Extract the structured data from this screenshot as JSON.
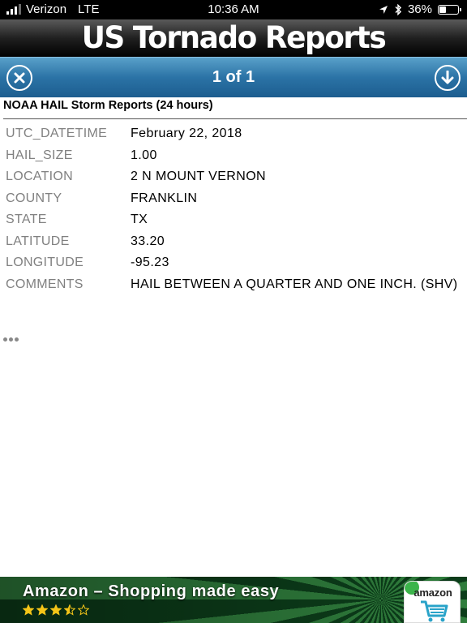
{
  "status_bar": {
    "carrier": "Verizon",
    "network": "LTE",
    "time": "10:36 AM",
    "battery": "36%",
    "battery_level": 0.36
  },
  "app": {
    "title": "US Tornado Reports"
  },
  "nav": {
    "pager": "1 of 1",
    "close_icon": "close-circle-icon",
    "download_icon": "download-circle-icon"
  },
  "section": {
    "title": "NOAA HAIL Storm Reports (24 hours)"
  },
  "records": [
    {
      "label": "UTC_DATETIME",
      "value": "February 22, 2018"
    },
    {
      "label": "HAIL_SIZE",
      "value": "1.00"
    },
    {
      "label": "LOCATION",
      "value": "2 N MOUNT VERNON"
    },
    {
      "label": "COUNTY",
      "value": "FRANKLIN"
    },
    {
      "label": "STATE",
      "value": "TX"
    },
    {
      "label": "LATITUDE",
      "value": "33.20"
    },
    {
      "label": "LONGITUDE",
      "value": "-95.23"
    },
    {
      "label": "COMMENTS",
      "value": "HAIL BETWEEN A QUARTER AND ONE INCH. (SHV)"
    }
  ],
  "more": {
    "icon": "more-ellipsis-icon"
  },
  "ad": {
    "title": "Amazon – Shopping made easy",
    "rating": 3.5,
    "rating_max": 5,
    "brand": "amazon",
    "colors": {
      "star": "#f5c518",
      "banner": "#1d5c2a"
    }
  },
  "colors": {
    "status_bar": "#000000",
    "nav_bar": "#2b73a6",
    "label_text": "#808080"
  }
}
